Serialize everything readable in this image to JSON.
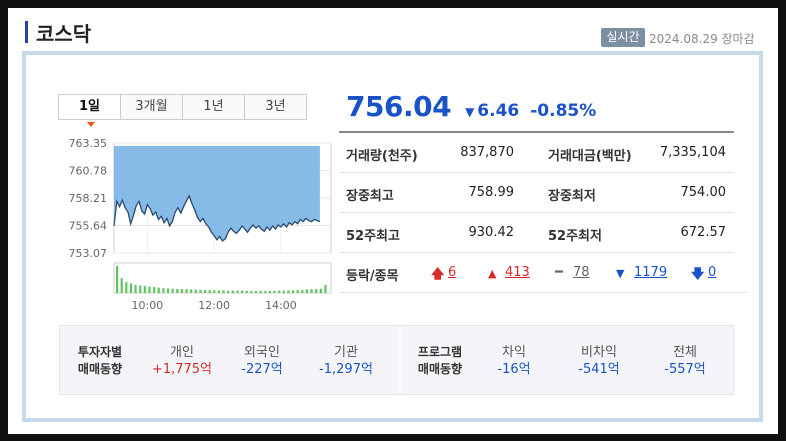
{
  "header": {
    "title": "코스닥",
    "live_badge": "실시간",
    "date_status": "2024.08.29 장마감"
  },
  "tabs": [
    {
      "label": "1일",
      "active": true
    },
    {
      "label": "3개월",
      "active": false
    },
    {
      "label": "1년",
      "active": false
    },
    {
      "label": "3년",
      "active": false
    }
  ],
  "price": {
    "current": "756.04",
    "change": "6.46",
    "change_pct": "-0.85%",
    "direction": "down",
    "color": "#1a52c8"
  },
  "stats": [
    {
      "label1": "거래량(천주)",
      "value1": "837,870",
      "label2": "거래대금(백만)",
      "value2": "7,335,104"
    },
    {
      "label1": "장중최고",
      "value1": "758.99",
      "label2": "장중최저",
      "value2": "754.00"
    },
    {
      "label1": "52주최고",
      "value1": "930.42",
      "label2": "52주최저",
      "value2": "672.57"
    }
  ],
  "breadth": {
    "label": "등락/종목",
    "upper_limit": "6",
    "rise": "413",
    "flat": "78",
    "fall": "1179",
    "lower_limit": "0"
  },
  "flow": {
    "investor_head": "투자자별\n매매동향",
    "program_head": "프로그램\n매매동향",
    "investor": [
      {
        "label": "개인",
        "value": "+1,775억",
        "sign": "up"
      },
      {
        "label": "외국인",
        "value": "-227억",
        "sign": "down"
      },
      {
        "label": "기관",
        "value": "-1,297억",
        "sign": "down"
      }
    ],
    "program": [
      {
        "label": "차익",
        "value": "-16억",
        "sign": "down"
      },
      {
        "label": "비차익",
        "value": "-541억",
        "sign": "down"
      },
      {
        "label": "전체",
        "value": "-557억",
        "sign": "down"
      }
    ]
  },
  "chart_data": {
    "type": "area",
    "y_ticks": [
      "763.35",
      "760.78",
      "758.21",
      "755.64",
      "753.07"
    ],
    "ylim": [
      753.07,
      763.35
    ],
    "x_ticks": [
      "10:00",
      "12:00",
      "14:00"
    ],
    "xlim_minutes": [
      540,
      930
    ],
    "grid": true,
    "fill_color": "#7fb6e6",
    "volume_color": "#5cc45a",
    "series": [
      {
        "values": [
          {
            "t": 540,
            "v": 755.6
          },
          {
            "t": 545,
            "v": 757.9
          },
          {
            "t": 550,
            "v": 757.4
          },
          {
            "t": 555,
            "v": 758.0
          },
          {
            "t": 560,
            "v": 757.3
          },
          {
            "t": 565,
            "v": 756.9
          },
          {
            "t": 570,
            "v": 755.8
          },
          {
            "t": 575,
            "v": 756.6
          },
          {
            "t": 580,
            "v": 757.5
          },
          {
            "t": 585,
            "v": 757.9
          },
          {
            "t": 590,
            "v": 757.0
          },
          {
            "t": 595,
            "v": 756.7
          },
          {
            "t": 600,
            "v": 757.6
          },
          {
            "t": 605,
            "v": 757.2
          },
          {
            "t": 610,
            "v": 756.6
          },
          {
            "t": 615,
            "v": 756.9
          },
          {
            "t": 620,
            "v": 756.2
          },
          {
            "t": 625,
            "v": 756.5
          },
          {
            "t": 630,
            "v": 755.9
          },
          {
            "t": 635,
            "v": 756.3
          },
          {
            "t": 640,
            "v": 755.6
          },
          {
            "t": 645,
            "v": 756.0
          },
          {
            "t": 650,
            "v": 756.9
          },
          {
            "t": 655,
            "v": 757.3
          },
          {
            "t": 660,
            "v": 756.8
          },
          {
            "t": 665,
            "v": 757.4
          },
          {
            "t": 670,
            "v": 757.9
          },
          {
            "t": 675,
            "v": 758.4
          },
          {
            "t": 680,
            "v": 757.7
          },
          {
            "t": 685,
            "v": 757.1
          },
          {
            "t": 690,
            "v": 756.4
          },
          {
            "t": 695,
            "v": 756.0
          },
          {
            "t": 700,
            "v": 756.3
          },
          {
            "t": 705,
            "v": 755.8
          },
          {
            "t": 710,
            "v": 755.5
          },
          {
            "t": 715,
            "v": 755.0
          },
          {
            "t": 720,
            "v": 754.7
          },
          {
            "t": 725,
            "v": 754.3
          },
          {
            "t": 730,
            "v": 754.6
          },
          {
            "t": 735,
            "v": 754.2
          },
          {
            "t": 740,
            "v": 754.4
          },
          {
            "t": 745,
            "v": 755.0
          },
          {
            "t": 750,
            "v": 755.4
          },
          {
            "t": 755,
            "v": 755.1
          },
          {
            "t": 760,
            "v": 754.9
          },
          {
            "t": 765,
            "v": 755.2
          },
          {
            "t": 770,
            "v": 755.6
          },
          {
            "t": 775,
            "v": 755.3
          },
          {
            "t": 780,
            "v": 755.0
          },
          {
            "t": 785,
            "v": 755.4
          },
          {
            "t": 790,
            "v": 755.7
          },
          {
            "t": 795,
            "v": 755.4
          },
          {
            "t": 800,
            "v": 755.6
          },
          {
            "t": 805,
            "v": 755.3
          },
          {
            "t": 810,
            "v": 755.1
          },
          {
            "t": 815,
            "v": 755.5
          },
          {
            "t": 820,
            "v": 755.2
          },
          {
            "t": 825,
            "v": 755.6
          },
          {
            "t": 830,
            "v": 755.3
          },
          {
            "t": 835,
            "v": 755.7
          },
          {
            "t": 840,
            "v": 755.5
          },
          {
            "t": 845,
            "v": 755.8
          },
          {
            "t": 850,
            "v": 755.5
          },
          {
            "t": 855,
            "v": 755.9
          },
          {
            "t": 860,
            "v": 755.7
          },
          {
            "t": 865,
            "v": 756.0
          },
          {
            "t": 870,
            "v": 755.8
          },
          {
            "t": 875,
            "v": 756.2
          },
          {
            "t": 880,
            "v": 756.0
          },
          {
            "t": 885,
            "v": 756.3
          },
          {
            "t": 890,
            "v": 756.1
          },
          {
            "t": 895,
            "v": 756.0
          },
          {
            "t": 900,
            "v": 756.2
          },
          {
            "t": 910,
            "v": 756.0
          }
        ]
      }
    ],
    "volume": [
      1.0,
      0.55,
      0.4,
      0.35,
      0.3,
      0.28,
      0.26,
      0.24,
      0.22,
      0.2,
      0.18,
      0.17,
      0.16,
      0.15,
      0.14,
      0.14,
      0.13,
      0.12,
      0.12,
      0.11,
      0.11,
      0.1,
      0.1,
      0.1,
      0.09,
      0.09,
      0.09,
      0.09,
      0.08,
      0.08,
      0.08,
      0.08,
      0.08,
      0.08,
      0.08,
      0.09,
      0.09,
      0.1,
      0.1,
      0.11,
      0.12,
      0.13,
      0.14,
      0.15,
      0.16,
      0.3
    ]
  }
}
